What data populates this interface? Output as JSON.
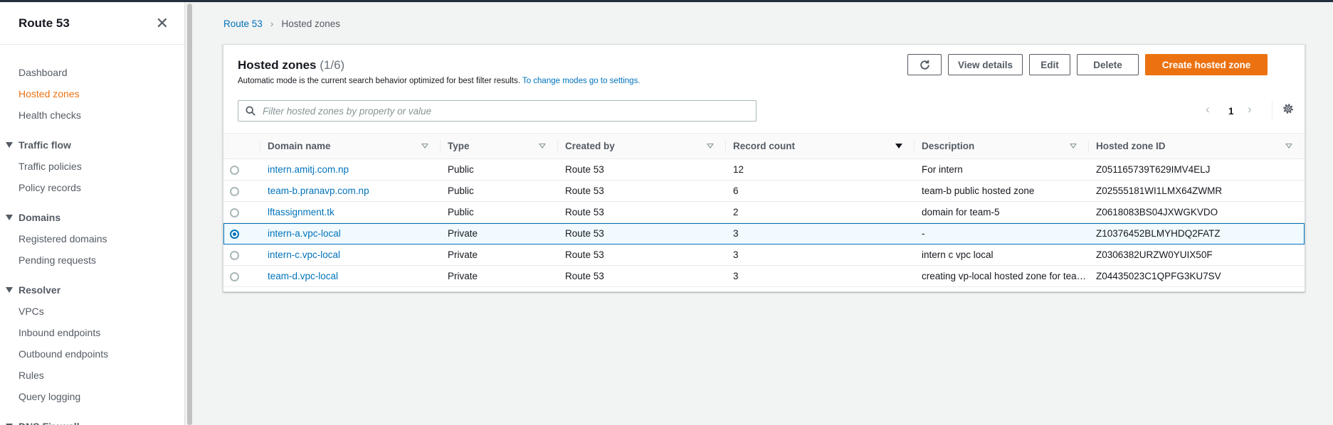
{
  "sidebar": {
    "title": "Route 53",
    "top_items": [
      {
        "label": "Dashboard",
        "active": false
      },
      {
        "label": "Hosted zones",
        "active": true
      },
      {
        "label": "Health checks",
        "active": false
      }
    ],
    "sections": [
      {
        "label": "Traffic flow",
        "items": [
          "Traffic policies",
          "Policy records"
        ]
      },
      {
        "label": "Domains",
        "items": [
          "Registered domains",
          "Pending requests"
        ]
      },
      {
        "label": "Resolver",
        "items": [
          "VPCs",
          "Inbound endpoints",
          "Outbound endpoints",
          "Rules",
          "Query logging"
        ]
      },
      {
        "label": "DNS Firewall",
        "items": []
      }
    ]
  },
  "breadcrumb": {
    "root": "Route 53",
    "current": "Hosted zones"
  },
  "panel": {
    "title": "Hosted zones",
    "count": "(1/6)",
    "desc": "Automatic mode is the current search behavior optimized for best filter results.",
    "desc_link": "To change modes go to settings.",
    "buttons": {
      "view_details": "View details",
      "edit": "Edit",
      "delete": "Delete",
      "create": "Create hosted zone"
    },
    "search_placeholder": "Filter hosted zones by property or value",
    "page": "1"
  },
  "table": {
    "columns": [
      "Domain name",
      "Type",
      "Created by",
      "Record count",
      "Description",
      "Hosted zone ID"
    ],
    "rows": [
      {
        "domain": "intern.amitj.com.np",
        "type": "Public",
        "created_by": "Route 53",
        "records": "12",
        "description": "For intern",
        "zone_id": "Z051165739T629IMV4ELJ",
        "selected": false
      },
      {
        "domain": "team-b.pranavp.com.np",
        "type": "Public",
        "created_by": "Route 53",
        "records": "6",
        "description": "team-b public hosted zone",
        "zone_id": "Z02555181WI1LMX64ZWMR",
        "selected": false
      },
      {
        "domain": "lftassignment.tk",
        "type": "Public",
        "created_by": "Route 53",
        "records": "2",
        "description": "domain for team-5",
        "zone_id": "Z0618083BS04JXWGKVDO",
        "selected": false
      },
      {
        "domain": "intern-a.vpc-local",
        "type": "Private",
        "created_by": "Route 53",
        "records": "3",
        "description": "-",
        "zone_id": "Z10376452BLMYHDQ2FATZ",
        "selected": true
      },
      {
        "domain": "intern-c.vpc-local",
        "type": "Private",
        "created_by": "Route 53",
        "records": "3",
        "description": "intern c vpc local",
        "zone_id": "Z0306382URZW0YUIX50F",
        "selected": false
      },
      {
        "domain": "team-d.vpc-local",
        "type": "Private",
        "created_by": "Route 53",
        "records": "3",
        "description": "creating vp-local hosted zone for team-d",
        "zone_id": "Z04435023C1QPFG3KU7SV",
        "selected": false
      }
    ]
  },
  "colors": {
    "accent": "#ec7211",
    "link": "#0073bb",
    "nav": "#232f3e"
  }
}
